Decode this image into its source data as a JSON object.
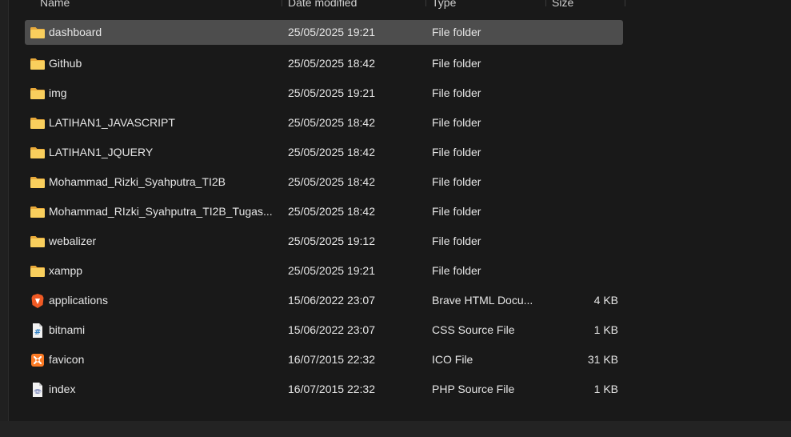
{
  "columns": {
    "name": "Name",
    "date": "Date modified",
    "type": "Type",
    "size": "Size"
  },
  "files": [
    {
      "name": "dashboard",
      "date": "25/05/2025 19:21",
      "type": "File folder",
      "size": "",
      "icon": "folder-icon",
      "selected": true
    },
    {
      "name": "Github",
      "date": "25/05/2025 18:42",
      "type": "File folder",
      "size": "",
      "icon": "folder-icon"
    },
    {
      "name": "img",
      "date": "25/05/2025 19:21",
      "type": "File folder",
      "size": "",
      "icon": "folder-icon"
    },
    {
      "name": "LATIHAN1_JAVASCRIPT",
      "date": "25/05/2025 18:42",
      "type": "File folder",
      "size": "",
      "icon": "folder-icon"
    },
    {
      "name": "LATIHAN1_JQUERY",
      "date": "25/05/2025 18:42",
      "type": "File folder",
      "size": "",
      "icon": "folder-icon"
    },
    {
      "name": "Mohammad_Rizki_Syahputra_TI2B",
      "date": "25/05/2025 18:42",
      "type": "File folder",
      "size": "",
      "icon": "folder-icon"
    },
    {
      "name": "Mohammad_RIzki_Syahputra_TI2B_Tugas...",
      "date": "25/05/2025 18:42",
      "type": "File folder",
      "size": "",
      "icon": "folder-icon"
    },
    {
      "name": "webalizer",
      "date": "25/05/2025 19:12",
      "type": "File folder",
      "size": "",
      "icon": "folder-icon"
    },
    {
      "name": "xampp",
      "date": "25/05/2025 19:21",
      "type": "File folder",
      "size": "",
      "icon": "folder-icon"
    },
    {
      "name": "applications",
      "date": "15/06/2022 23:07",
      "type": "Brave HTML Docu...",
      "size": "4 KB",
      "icon": "brave-html-icon"
    },
    {
      "name": "bitnami",
      "date": "15/06/2022 23:07",
      "type": "CSS Source File",
      "size": "1 KB",
      "icon": "css-file-icon"
    },
    {
      "name": "favicon",
      "date": "16/07/2015 22:32",
      "type": "ICO File",
      "size": "31 KB",
      "icon": "xampp-ico-icon"
    },
    {
      "name": "index",
      "date": "16/07/2015 22:32",
      "type": "PHP Source File",
      "size": "1 KB",
      "icon": "php-file-icon"
    }
  ],
  "colors": {
    "background": "#191919",
    "selected_row": "#4d4d4d",
    "folder": "#f4c54c",
    "text": "#e6e6e6"
  }
}
